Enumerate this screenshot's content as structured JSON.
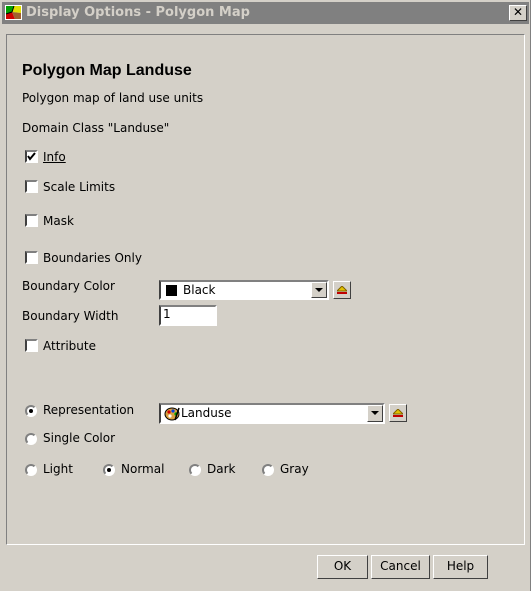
{
  "window": {
    "title": "Display Options - Polygon Map",
    "close_glyph": "✕",
    "icon": "polygon-map-icon"
  },
  "header": {
    "heading": "Polygon Map  Landuse",
    "description": "Polygon map of land use units",
    "domain": "Domain Class \"Landuse\""
  },
  "options": {
    "info": {
      "label": "Info",
      "checked": true
    },
    "scale_limits": {
      "label": "Scale Limits",
      "checked": false
    },
    "mask": {
      "label": "Mask",
      "checked": false
    },
    "boundaries_only": {
      "label": "Boundaries Only",
      "checked": false
    },
    "attribute": {
      "label": "Attribute",
      "checked": false
    }
  },
  "boundary": {
    "color_label": "Boundary Color",
    "color_value": "Black",
    "color_swatch": "#000000",
    "width_label": "Boundary Width",
    "width_value": "1"
  },
  "representation": {
    "label": "Representation",
    "selected": true,
    "value": "Landuse",
    "icon": "palette-icon"
  },
  "single_color": {
    "label": "Single Color",
    "selected": false
  },
  "shading": [
    {
      "label": "Light",
      "selected": false
    },
    {
      "label": "Normal",
      "selected": true
    },
    {
      "label": "Dark",
      "selected": false
    },
    {
      "label": "Gray",
      "selected": false
    }
  ],
  "buttons": {
    "ok": "OK",
    "cancel": "Cancel",
    "help": "Help"
  }
}
